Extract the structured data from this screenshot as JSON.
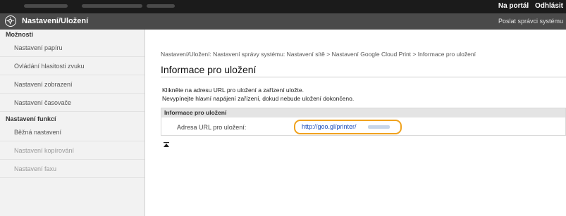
{
  "header": {
    "links": [
      "Na portál",
      "Odhlásit"
    ],
    "title": "Nastavení/Uložení",
    "admin_link": "Poslat správci systému"
  },
  "sidebar": {
    "groups": [
      {
        "label": "Možnosti",
        "items": [
          "Nastavení papíru",
          "Ovládání hlasitosti zvuku",
          "Nastavení zobrazení",
          "Nastavení časovače"
        ]
      },
      {
        "label": "Nastavení funkcí",
        "items": [
          "Běžná nastavení",
          "Nastavení kopírování",
          "Nastavení faxu"
        ]
      }
    ]
  },
  "main": {
    "breadcrumb": "Nastavení/Uložení: Nastavení správy systému: Nastavení sítě > Nastavení Google Cloud Print > Informace pro uložení",
    "page_title": "Informace pro uložení",
    "instructions": [
      "Klikněte na adresu URL pro uložení a zařízení uložte.",
      "Nevypínejte hlavní napájení zařízení, dokud nebude uložení dokončeno."
    ],
    "panel": {
      "header": "Informace pro uložení",
      "row_label": "Adresa URL pro uložení:",
      "url": "http://goo.gl/printer/"
    }
  },
  "colors": {
    "topbar": "#1b1b1b",
    "titlebar": "#4a4a4a",
    "highlight": "#f0a21e",
    "link": "#1a4dbd"
  }
}
